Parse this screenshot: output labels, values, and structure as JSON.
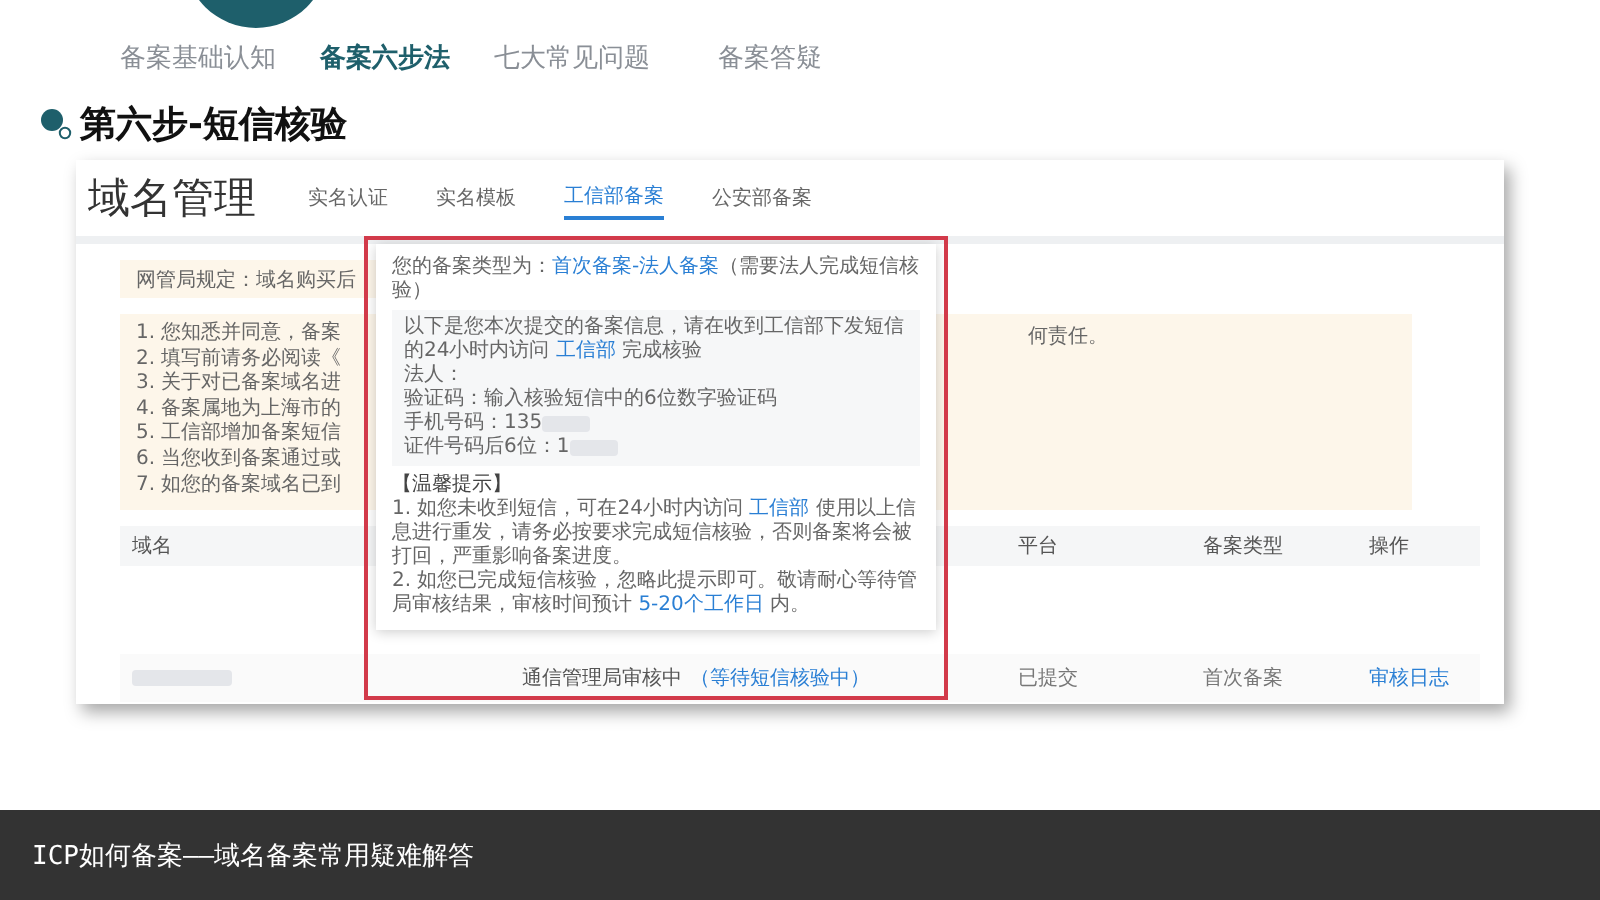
{
  "nav": {
    "tabs": [
      {
        "label": "备案基础认知",
        "selected": false
      },
      {
        "label": "备案六步法",
        "selected": true
      },
      {
        "label": "七大常见问题",
        "selected": false
      },
      {
        "label": "备案答疑",
        "selected": false
      }
    ]
  },
  "heading": "第六步-短信核验",
  "screenshot": {
    "title": "域名管理",
    "tabs": [
      {
        "label": "实名认证",
        "selected": false
      },
      {
        "label": "实名模板",
        "selected": false
      },
      {
        "label": "工信部备案",
        "selected": true
      },
      {
        "label": "公安部备案",
        "selected": false
      }
    ],
    "notice": "网管局规定：域名购买后",
    "list_left": [
      "1. 您知悉并同意，备案",
      "2. 填写前请务必阅读《",
      "3. 关于对已备案域名进",
      "4. 备案属地为上海市的",
      "5. 工信部增加备案短信",
      "6. 当您收到备案通过或",
      "7. 如您的备案域名已到"
    ],
    "list_right": "何责任。",
    "popup": {
      "type_label": "您的备案类型为：",
      "type_value": "首次备案-法人备案",
      "type_note": "（需要法人完成短信核验）",
      "intro": {
        "before": "以下是您本次提交的备案信息，请在收到工信部下发短信的24小时内访问 ",
        "link": "工信部",
        "after": " 完成核验"
      },
      "fields": [
        {
          "label": "法人："
        },
        {
          "label": "验证码：",
          "value": "输入核验短信中的6位数字验证码"
        },
        {
          "label": "手机号码：",
          "value": "135"
        },
        {
          "label": "证件号码后6位：",
          "value": "1"
        }
      ],
      "tips_title": "【温馨提示】",
      "tips": [
        {
          "before": "1. 如您未收到短信，可在24小时内访问 ",
          "link": "工信部",
          "after": " 使用以上信息进行重发，请务必按要求完成短信核验，否则备案将会被打回，严重影响备案进度。"
        },
        {
          "before": "2. 如您已完成短信核验，忽略此提示即可。敬请耐心等待管局审核结果，审核时间预计 ",
          "link": "5-20个工作日",
          "after": " 内。"
        }
      ]
    },
    "table": {
      "columns": [
        "域名",
        "平台",
        "备案类型",
        "操作"
      ],
      "row": {
        "status": "通信管理局审核中",
        "status_link": "（等待短信核验中）",
        "submitted": "已提交",
        "type": "首次备案",
        "action": "审核日志"
      }
    }
  },
  "caption": "ICP如何备案——域名备案常用疑难解答"
}
